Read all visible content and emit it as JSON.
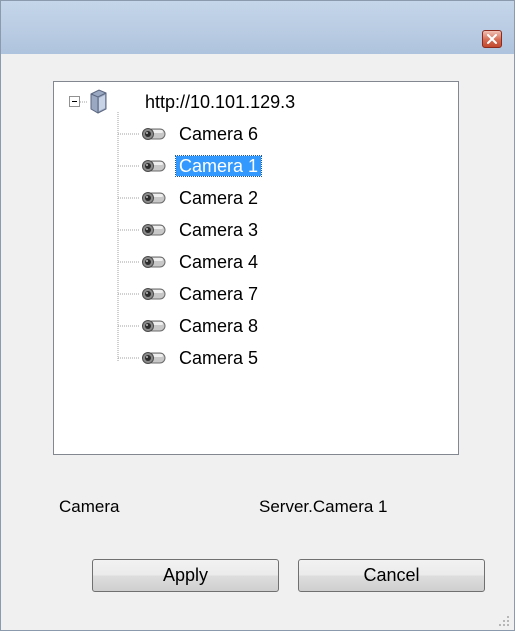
{
  "window": {
    "close_icon": "close-icon"
  },
  "tree": {
    "root": {
      "label": "http://10.101.129.3",
      "icon": "server-icon",
      "expanded": true
    },
    "items": [
      {
        "label": "Camera 6",
        "icon": "camera-icon",
        "selected": false
      },
      {
        "label": "Camera 1",
        "icon": "camera-icon",
        "selected": true
      },
      {
        "label": "Camera 2",
        "icon": "camera-icon",
        "selected": false
      },
      {
        "label": "Camera 3",
        "icon": "camera-icon",
        "selected": false
      },
      {
        "label": "Camera 4",
        "icon": "camera-icon",
        "selected": false
      },
      {
        "label": "Camera 7",
        "icon": "camera-icon",
        "selected": false
      },
      {
        "label": "Camera 8",
        "icon": "camera-icon",
        "selected": false
      },
      {
        "label": "Camera 5",
        "icon": "camera-icon",
        "selected": false
      }
    ]
  },
  "selection": {
    "caption": "Camera",
    "value": "Server.Camera 1"
  },
  "buttons": {
    "apply": "Apply",
    "cancel": "Cancel"
  },
  "colors": {
    "selection_bg": "#3399ff",
    "titlebar": "#b8cbe2"
  }
}
